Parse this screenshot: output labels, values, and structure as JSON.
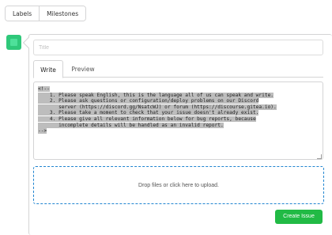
{
  "toolbar": {
    "labels_label": "Labels",
    "milestones_label": "Milestones"
  },
  "issue": {
    "title_placeholder": "Title",
    "tabs": [
      {
        "label": "Write"
      },
      {
        "label": "Preview"
      }
    ],
    "editor_lines": [
      "<!--",
      "    1. Please speak English, this is the language all of us can speak and write.",
      "    2. Please ask questions or configuration/deploy problems on our Discord",
      "       server (https://discord.gg/NsatcWJ) or forum (https://discourse.gitea.io).",
      "    3. Please take a moment to check that your issue doesn't already exist.",
      "    4. Please give all relevant information below for bug reports, because",
      "       incomplete details will be handled as an invalid report.",
      "-->"
    ],
    "dropzone_text": "Drop files or click here to upload.",
    "create_label": "Create Issue"
  },
  "colors": {
    "avatar": "#2fc87a",
    "create_button": "#21ba45",
    "dropzone_border": "#2185d0"
  }
}
